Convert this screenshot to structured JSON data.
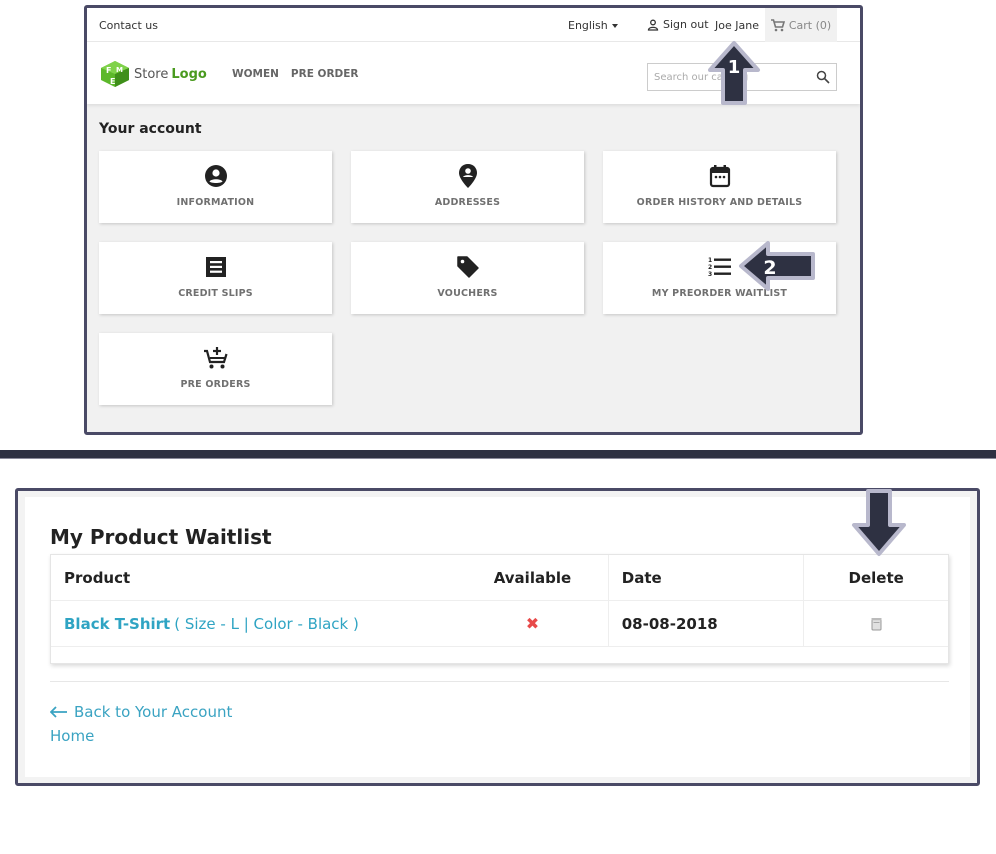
{
  "top_screenshot": {
    "topbar": {
      "contact_label": "Contact us",
      "language": "English",
      "signout_label": "Sign out",
      "username": "Joe Jane",
      "cart_label": "Cart (0)"
    },
    "header": {
      "logo_text_1": "Store",
      "logo_text_2": "Logo",
      "nav": [
        "WOMEN",
        "PRE ORDER"
      ],
      "search_placeholder": "Search our catalog"
    },
    "account": {
      "title": "Your account",
      "tiles": [
        {
          "label": "INFORMATION",
          "icon": "account-circle-icon"
        },
        {
          "label": "ADDRESSES",
          "icon": "location-pin-icon"
        },
        {
          "label": "ORDER HISTORY AND DETAILS",
          "icon": "calendar-icon"
        },
        {
          "label": "CREDIT SLIPS",
          "icon": "receipt-icon"
        },
        {
          "label": "VOUCHERS",
          "icon": "tag-icon"
        },
        {
          "label": "MY PREORDER WAITLIST",
          "icon": "numbered-list-icon"
        },
        {
          "label": "PRE ORDERS",
          "icon": "cart-plus-icon"
        }
      ]
    }
  },
  "annotations": {
    "step1": "1",
    "step2": "2"
  },
  "bottom_screenshot": {
    "title": "My Product Waitlist",
    "table": {
      "headers": [
        "Product",
        "Available",
        "Date",
        "Delete"
      ],
      "rows": [
        {
          "product_name": "Black T-Shirt",
          "product_attrs": "( Size - L | Color - Black )",
          "available": "✖",
          "date": "08-08-2018",
          "delete_icon": "trash-icon"
        }
      ]
    },
    "back_link": "Back to Your Account",
    "home_link": "Home"
  },
  "colors": {
    "frame": "#4a4a66",
    "link": "#2fa4c3",
    "logo_green": "#4a9a1f",
    "unavailable_red": "#e84a4a",
    "arrow_fill": "#2e3142"
  }
}
